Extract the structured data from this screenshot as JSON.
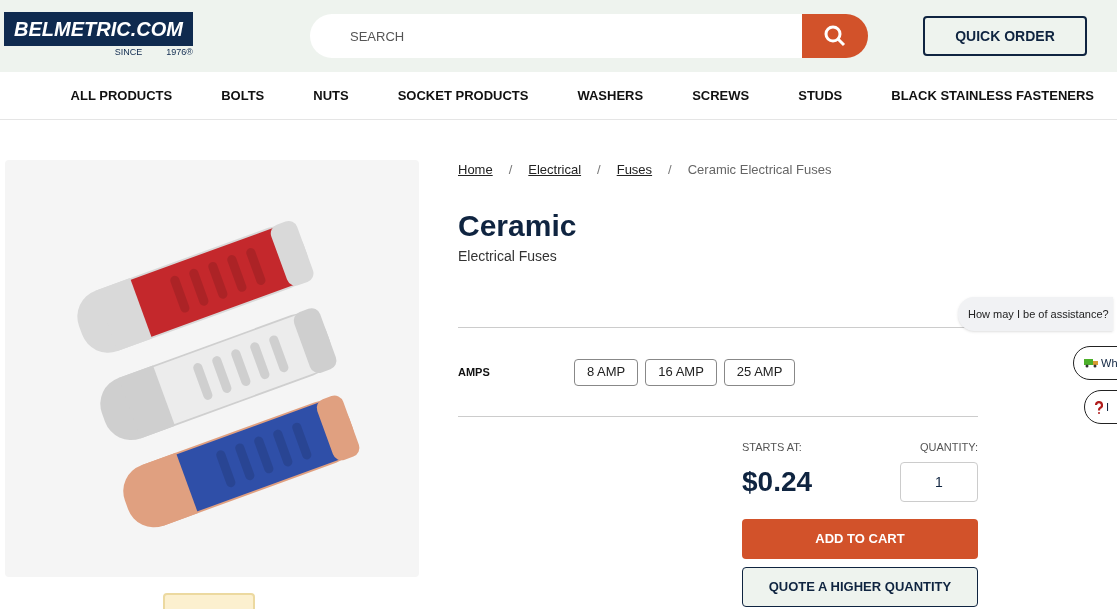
{
  "header": {
    "logo": {
      "name": "BELMETRIC.COM",
      "since": "SINCE",
      "year": "1976®"
    },
    "search": {
      "placeholder": "SEARCH"
    },
    "quick_order": "QUICK ORDER"
  },
  "nav": [
    "ALL PRODUCTS",
    "BOLTS",
    "NUTS",
    "SOCKET PRODUCTS",
    "WASHERS",
    "SCREWS",
    "STUDS",
    "BLACK STAINLESS FASTENERS"
  ],
  "breadcrumbs": [
    {
      "label": "Home",
      "link": true
    },
    {
      "label": "Electrical",
      "link": true
    },
    {
      "label": "Fuses",
      "link": true
    },
    {
      "label": "Ceramic Electrical Fuses",
      "link": false
    }
  ],
  "breadcrumb_separator": "/",
  "product": {
    "title": "Ceramic",
    "subtitle": "Electrical Fuses",
    "option_label": "AMPS",
    "options": [
      {
        "label": "8 AMP",
        "selected": false
      },
      {
        "label": "16 AMP",
        "selected": false
      },
      {
        "label": "25 AMP",
        "selected": false
      }
    ],
    "price_label": "STARTS AT:",
    "price": "$0.24",
    "quantity_label": "QUANTITY:",
    "quantity": "1",
    "add_to_cart": "ADD TO CART",
    "quote": "QUOTE A HIGHER QUANTITY"
  },
  "chat": {
    "message": "How may I be of assistance?",
    "chips": [
      {
        "kind": "truck",
        "label": "Wh"
      },
      {
        "kind": "question",
        "label": "I"
      }
    ]
  }
}
